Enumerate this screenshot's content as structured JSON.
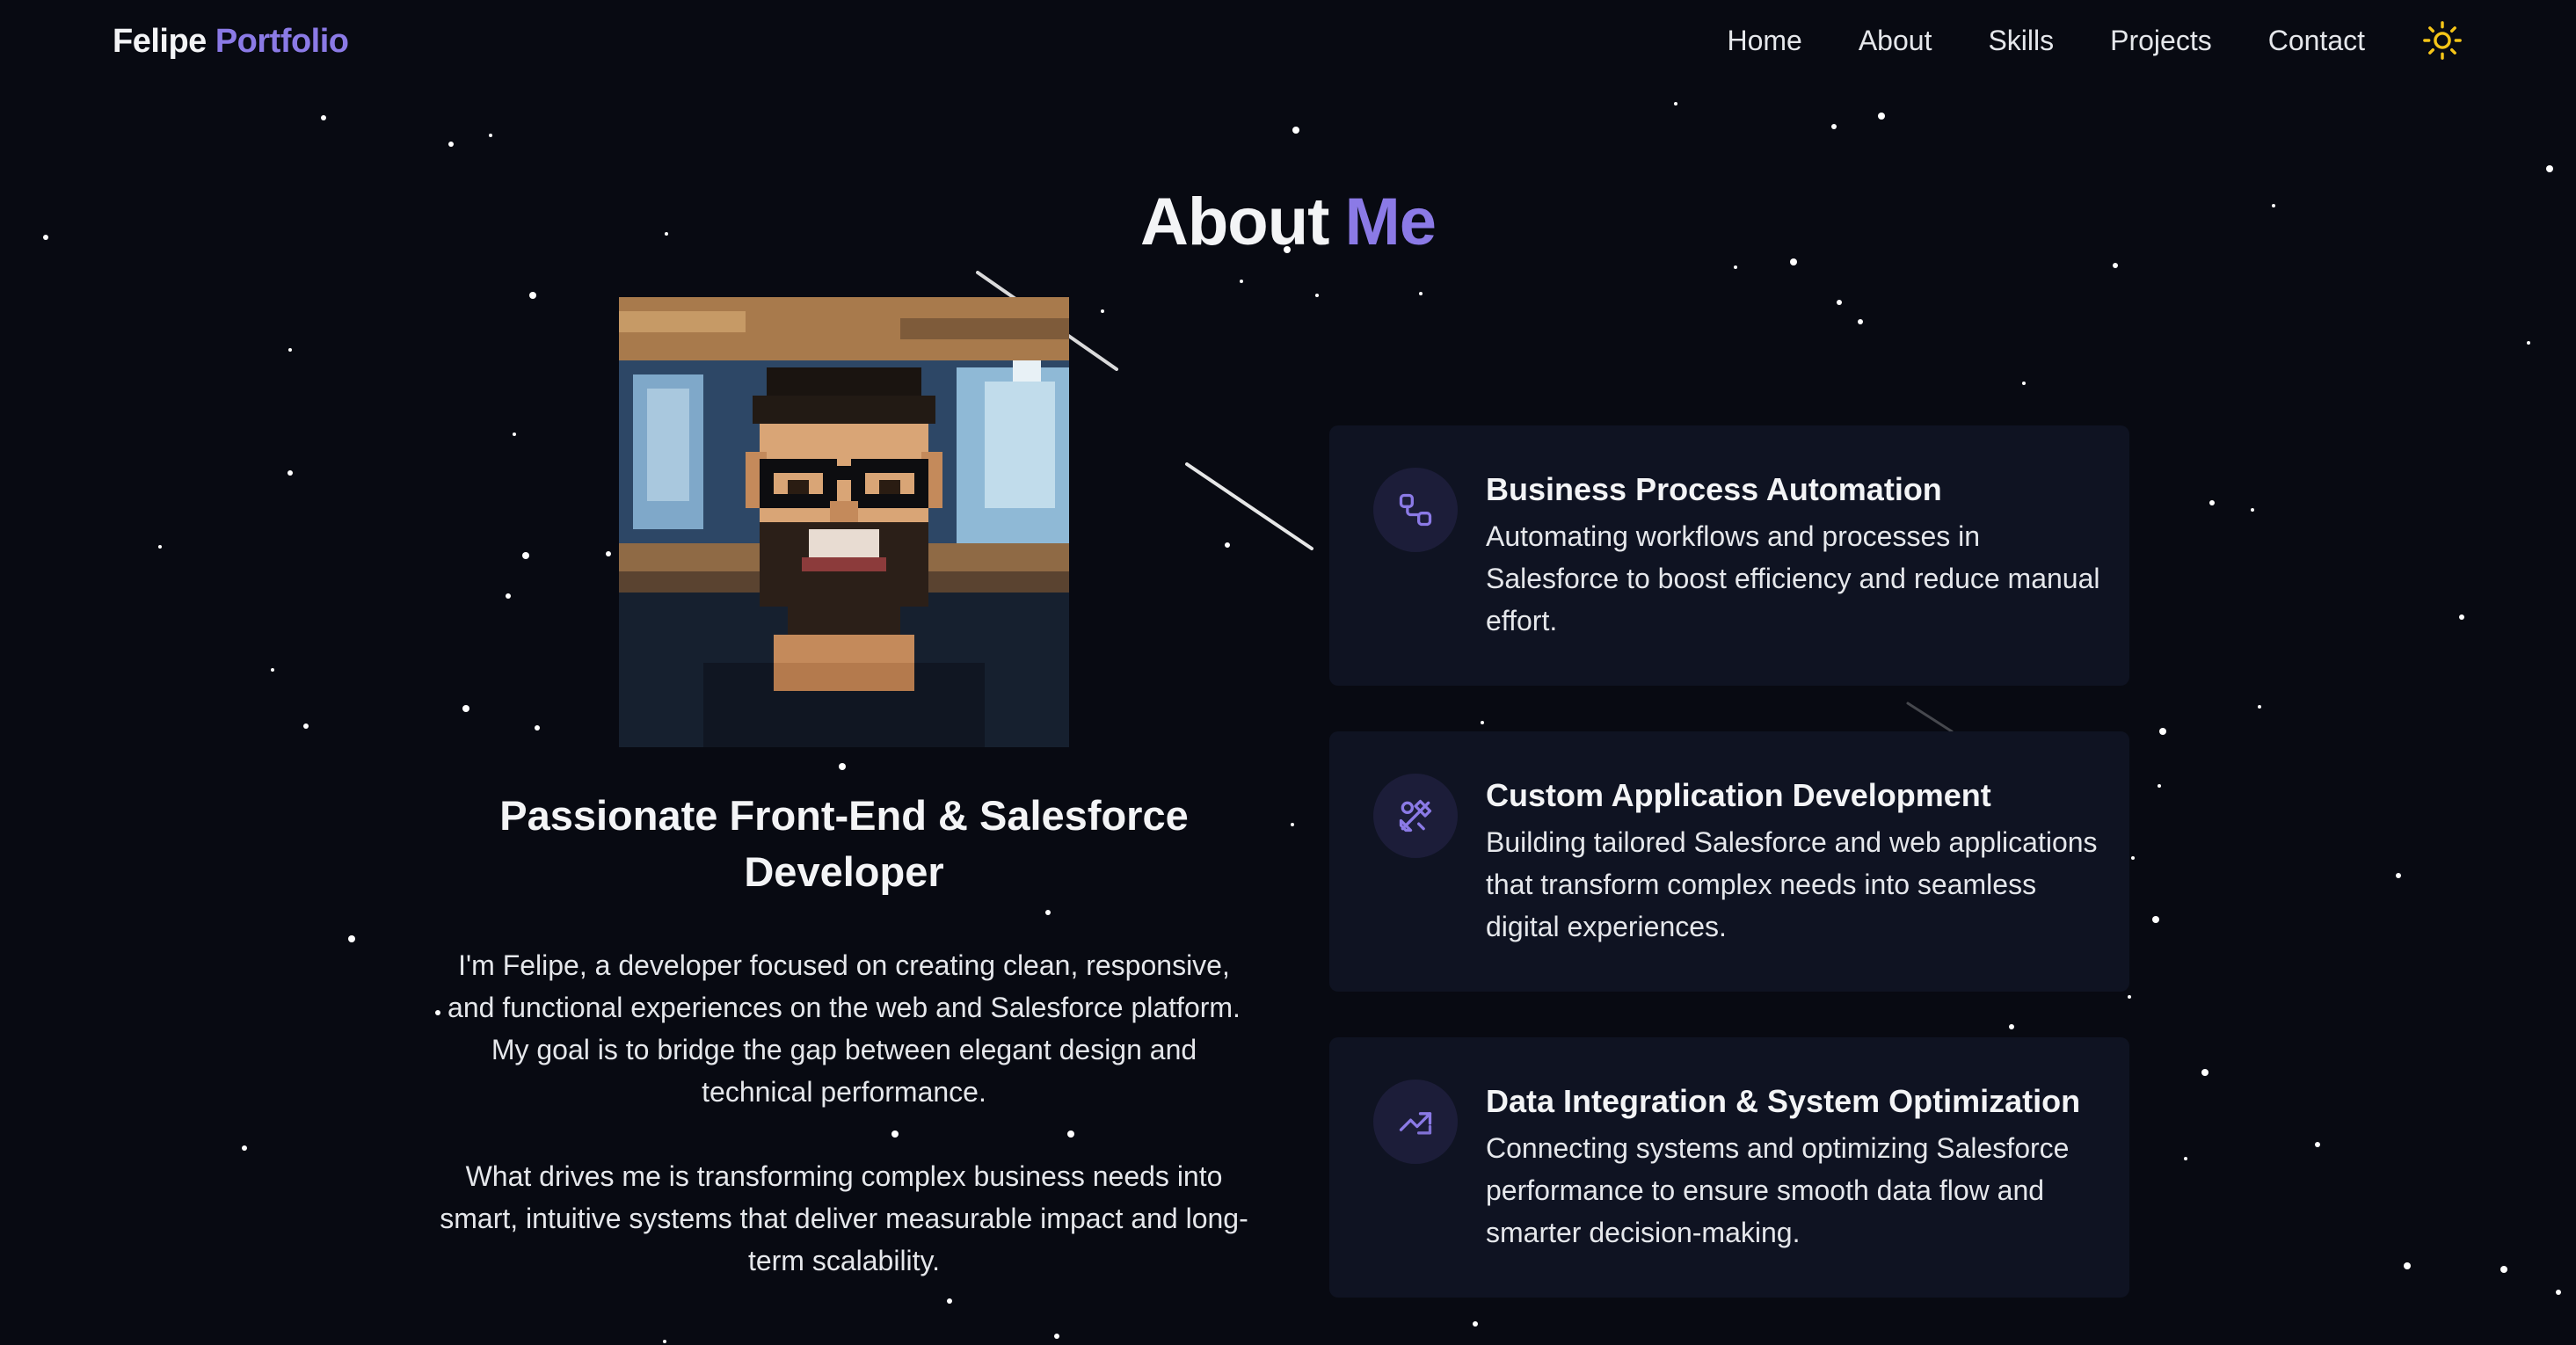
{
  "nav": {
    "brand_name": "Felipe",
    "brand_accent": "Portfolio",
    "links": [
      "Home",
      "About",
      "Skills",
      "Projects",
      "Contact"
    ],
    "theme_icon": "sun-icon"
  },
  "about": {
    "title": "About",
    "title_accent": "Me",
    "headline": "Passionate Front-End & Salesforce Developer",
    "bio": [
      "I'm Felipe, a developer focused on creating clean, responsive, and functional experiences on the web and Salesforce platform. My goal is to bridge the gap between elegant design and technical performance.",
      "What drives me is transforming complex business needs into smart, intuitive systems that deliver measurable impact and long-term scalability."
    ]
  },
  "services": [
    {
      "icon": "workflow-icon",
      "title": "Business Process Automation",
      "description": "Automating workflows and processes in Salesforce to boost efficiency and reduce manual effort."
    },
    {
      "icon": "tools-icon",
      "title": "Custom Application Development",
      "description": "Building tailored Salesforce and web applications that transform complex needs into seamless digital experiences."
    },
    {
      "icon": "trending-up-icon",
      "title": "Data Integration & System Optimization",
      "description": "Connecting systems and optimizing Salesforce performance to ensure smooth data flow and smarter decision-making."
    }
  ],
  "colors": {
    "background": "#080a12",
    "accent": "#8b7ae6",
    "card": "#0f1322",
    "icon_bg": "#1c1d39",
    "sun": "#f5c518"
  }
}
